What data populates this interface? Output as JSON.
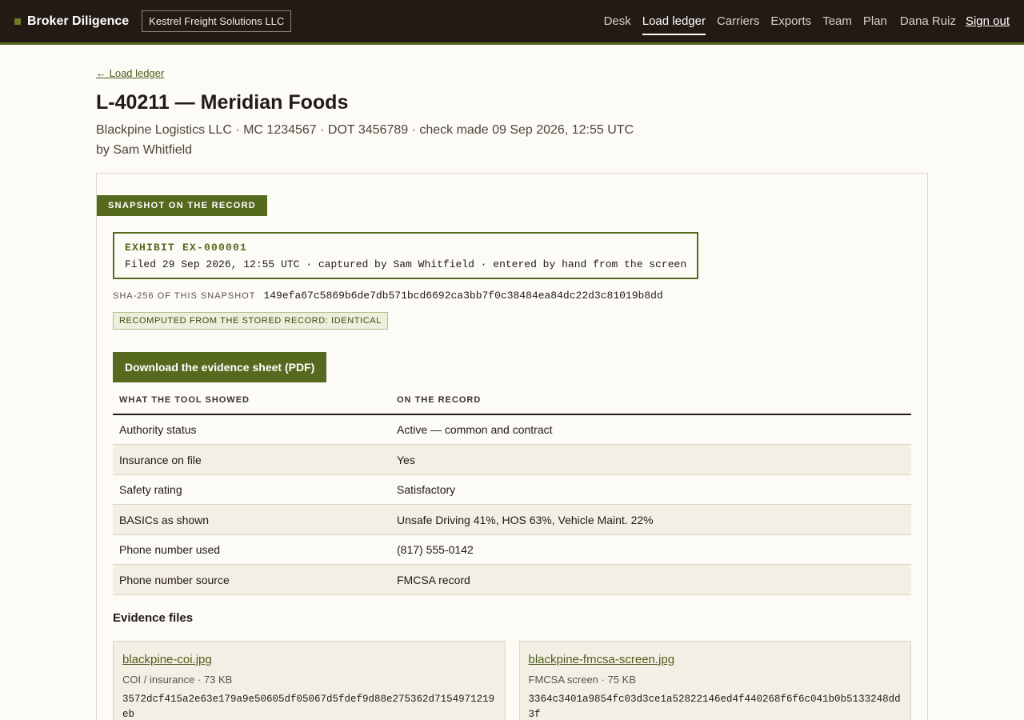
{
  "header": {
    "brand": "Broker Diligence",
    "org": "Kestrel Freight Solutions LLC",
    "nav": [
      "Desk",
      "Load ledger",
      "Carriers",
      "Exports",
      "Team",
      "Plan"
    ],
    "active_nav": "Load ledger",
    "user": "Dana Ruiz",
    "signout": "Sign out"
  },
  "page": {
    "back": "← Load ledger",
    "title": "L-40211 — Meridian Foods",
    "subtitle": "Blackpine Logistics LLC · MC 1234567 · DOT 3456789 · check made 09 Sep 2026, 12:55 UTC by Sam Whitfield"
  },
  "snapshot": {
    "tag": "SNAPSHOT ON THE RECORD",
    "exhibit_id": "EXHIBIT EX-000001",
    "exhibit_meta": "Filed 29 Sep 2026, 12:55 UTC · captured by Sam Whitfield · entered by hand from the screen",
    "hash_label": "SHA-256 OF THIS SNAPSHOT",
    "hash_value": "149efa67c5869b6de7db571bcd6692ca3bb7f0c38484ea84dc22d3c81019b8dd",
    "verify": "RECOMPUTED FROM THE STORED RECORD: IDENTICAL",
    "download": "Download the evidence sheet (PDF)"
  },
  "record_table": {
    "columns": [
      "WHAT THE TOOL SHOWED",
      "ON THE RECORD"
    ],
    "rows": [
      [
        "Authority status",
        "Active — common and contract"
      ],
      [
        "Insurance on file",
        "Yes"
      ],
      [
        "Safety rating",
        "Satisfactory"
      ],
      [
        "BASICs as shown",
        "Unsafe Driving 41%, HOS 63%, Vehicle Maint. 22%"
      ],
      [
        "Phone number used",
        "(817) 555-0142"
      ],
      [
        "Phone number source",
        "FMCSA record"
      ]
    ]
  },
  "evidence": {
    "heading": "Evidence files",
    "files": [
      {
        "name": "blackpine-coi.jpg",
        "meta": "COI / insurance · 73 KB",
        "hash": "3572dcf415a2e63e179a9e50605df05067d5fdef9d88e275362d7154971219eb"
      },
      {
        "name": "blackpine-fmcsa-screen.jpg",
        "meta": "FMCSA screen · 75 KB",
        "hash": "3364c3401a9854fc03d3ce1a52822146ed4f440268f6f6c041b0b5133248dd3f"
      }
    ]
  }
}
